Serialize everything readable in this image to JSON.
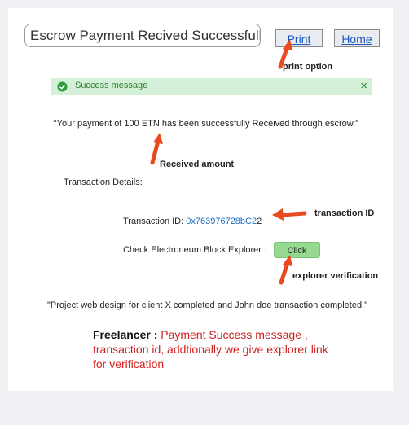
{
  "header": {
    "title_value": "Escrow Payment Recived Successfull",
    "print_label": "Print",
    "home_label": "Home"
  },
  "annotations": {
    "print_option": "print option",
    "received_amount": "Received amount",
    "transaction_id": "transaction ID",
    "explorer_verification": "explorer verification"
  },
  "success": {
    "message": "Success message",
    "close_symbol": "×"
  },
  "payment_message": "“Your payment of 100 ETN has been successfully Received through escrow.”",
  "transaction_details_label": "Transaction Details:",
  "transaction": {
    "label": "Transaction ID:",
    "id_link": "0x763976728bC2",
    "id_suffix": "2"
  },
  "explorer": {
    "label": "Check Electroneum Block Explorer :",
    "button_label": "Click"
  },
  "project_message": "\"Project web design for client  X completed and John doe transaction completed.\"",
  "freelancer_note": {
    "heading": "Freelancer :",
    "text": " Payment Success message , transaction id, addtionally we give explorer link for verification"
  },
  "colors": {
    "arrow": "#e8491d",
    "success_bg": "#d5f0d8",
    "success_text": "#2e7d32",
    "link": "#1a6fc2",
    "note_text": "#d32020",
    "click_button": "#94d98f"
  },
  "icons": {
    "success": "check-circle-icon",
    "close": "close-icon",
    "arrow": "arrow-icon"
  }
}
